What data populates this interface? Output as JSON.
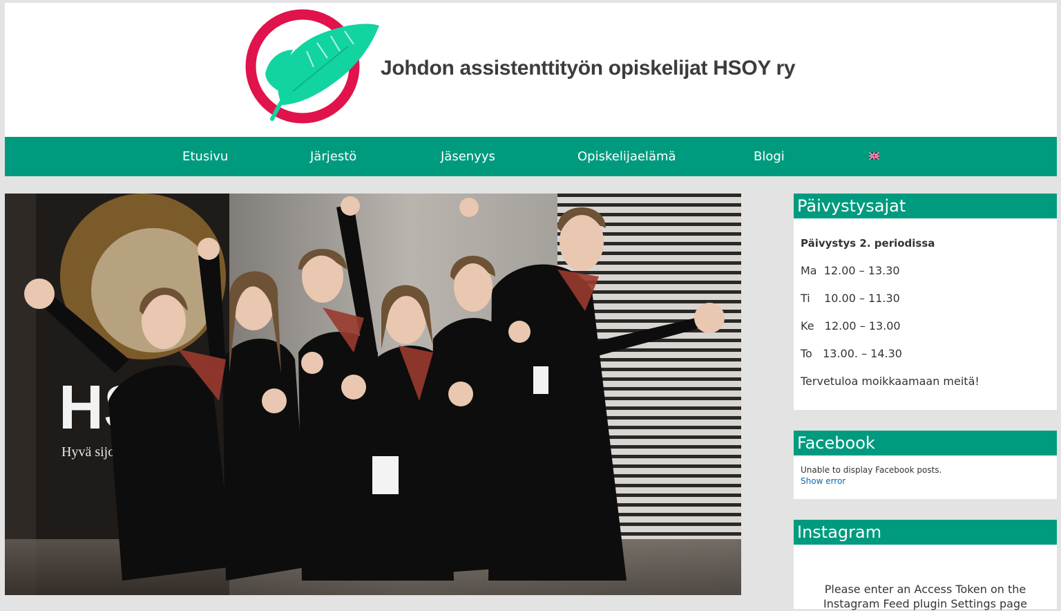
{
  "header": {
    "site_title": "Johdon assistenttityön opiskelijat HSOY ry"
  },
  "nav": {
    "items": [
      {
        "label": "Etusivu"
      },
      {
        "label": "Järjestö"
      },
      {
        "label": "Jäsenyys"
      },
      {
        "label": "Opiskelijaelämä"
      },
      {
        "label": "Blogi"
      }
    ],
    "language_flag": "uk-flag-icon"
  },
  "hero": {
    "banner_text_1": "HS",
    "banner_text_2": "Hyvä sijoitus os"
  },
  "sidebar": {
    "hours": {
      "title": "Päivystysajat",
      "heading": "Päivystys 2. periodissa",
      "rows": [
        "Ma  12.00 – 13.30",
        "Ti    10.00 – 11.30",
        "Ke   12.00 – 13.00",
        "To   13.00. – 14.30"
      ],
      "welcome": "Tervetuloa moikkaamaan meitä!"
    },
    "facebook": {
      "title": "Facebook",
      "message": "Unable to display Facebook posts.",
      "link": "Show error"
    },
    "instagram": {
      "title": "Instagram",
      "message_line1": "Please enter an Access Token on the",
      "message_line2": "Instagram Feed plugin Settings page"
    }
  },
  "colors": {
    "brand_green": "#009b7f",
    "logo_red": "#e0134d",
    "logo_mint": "#12d4a0",
    "page_bg": "#e3e3e3"
  }
}
